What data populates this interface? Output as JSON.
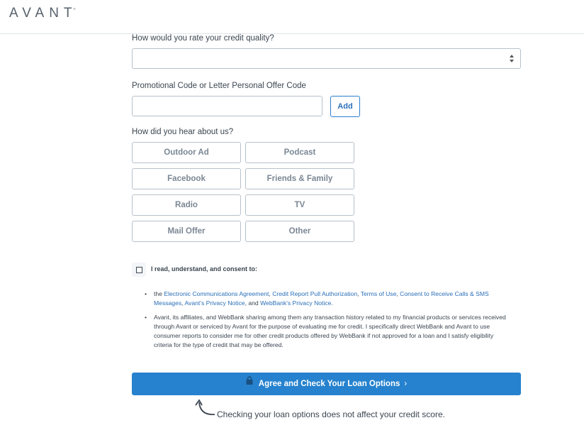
{
  "header": {
    "logo_text": "AVANT",
    "logo_mark": "®"
  },
  "form": {
    "credit_quality": {
      "label": "How would you rate your credit quality?",
      "value": ""
    },
    "promo": {
      "label": "Promotional Code or Letter Personal Offer Code",
      "value": "",
      "add_label": "Add"
    },
    "referral": {
      "label": "How did you hear about us?",
      "options": [
        "Outdoor Ad",
        "Podcast",
        "Facebook",
        "Friends & Family",
        "Radio",
        "TV",
        "Mail Offer",
        "Other"
      ]
    },
    "consent": {
      "checked": false,
      "label": "I read, understand, and consent to:",
      "bullet1": {
        "prefix": "the ",
        "link1": "Electronic Communications Agreement",
        "sep1": ", ",
        "link2": "Credit Report Pull Authorization",
        "sep2": ", ",
        "link3": "Terms of Use",
        "sep3": ", ",
        "link4": "Consent to Receive Calls & SMS Messages",
        "sep4": ", ",
        "link5": "Avant's Privacy Notice",
        "sep5": ", and ",
        "link6": "WebBank's Privacy Notice",
        "suffix": "."
      },
      "bullet2": "Avant, its affiliates, and WebBank sharing among them any transaction history related to my financial products or services received through Avant or serviced by Avant for the purpose of evaluating me for credit. I specifically direct WebBank and Avant to use consumer reports to consider me for other credit products offered by WebBank if not approved for a loan and I satisfy eligibility criteria for the type of credit that may be offered."
    },
    "submit": {
      "label": "Agree and Check Your Loan Options",
      "chevron": "›",
      "icon": "lock-icon"
    },
    "note": "Checking your loan options does not affect your credit score."
  },
  "colors": {
    "primary": "#2682ce",
    "link": "#2a6fb8",
    "border": "#b6c1cc",
    "text": "#3b4651",
    "option_text": "#7b8794"
  }
}
